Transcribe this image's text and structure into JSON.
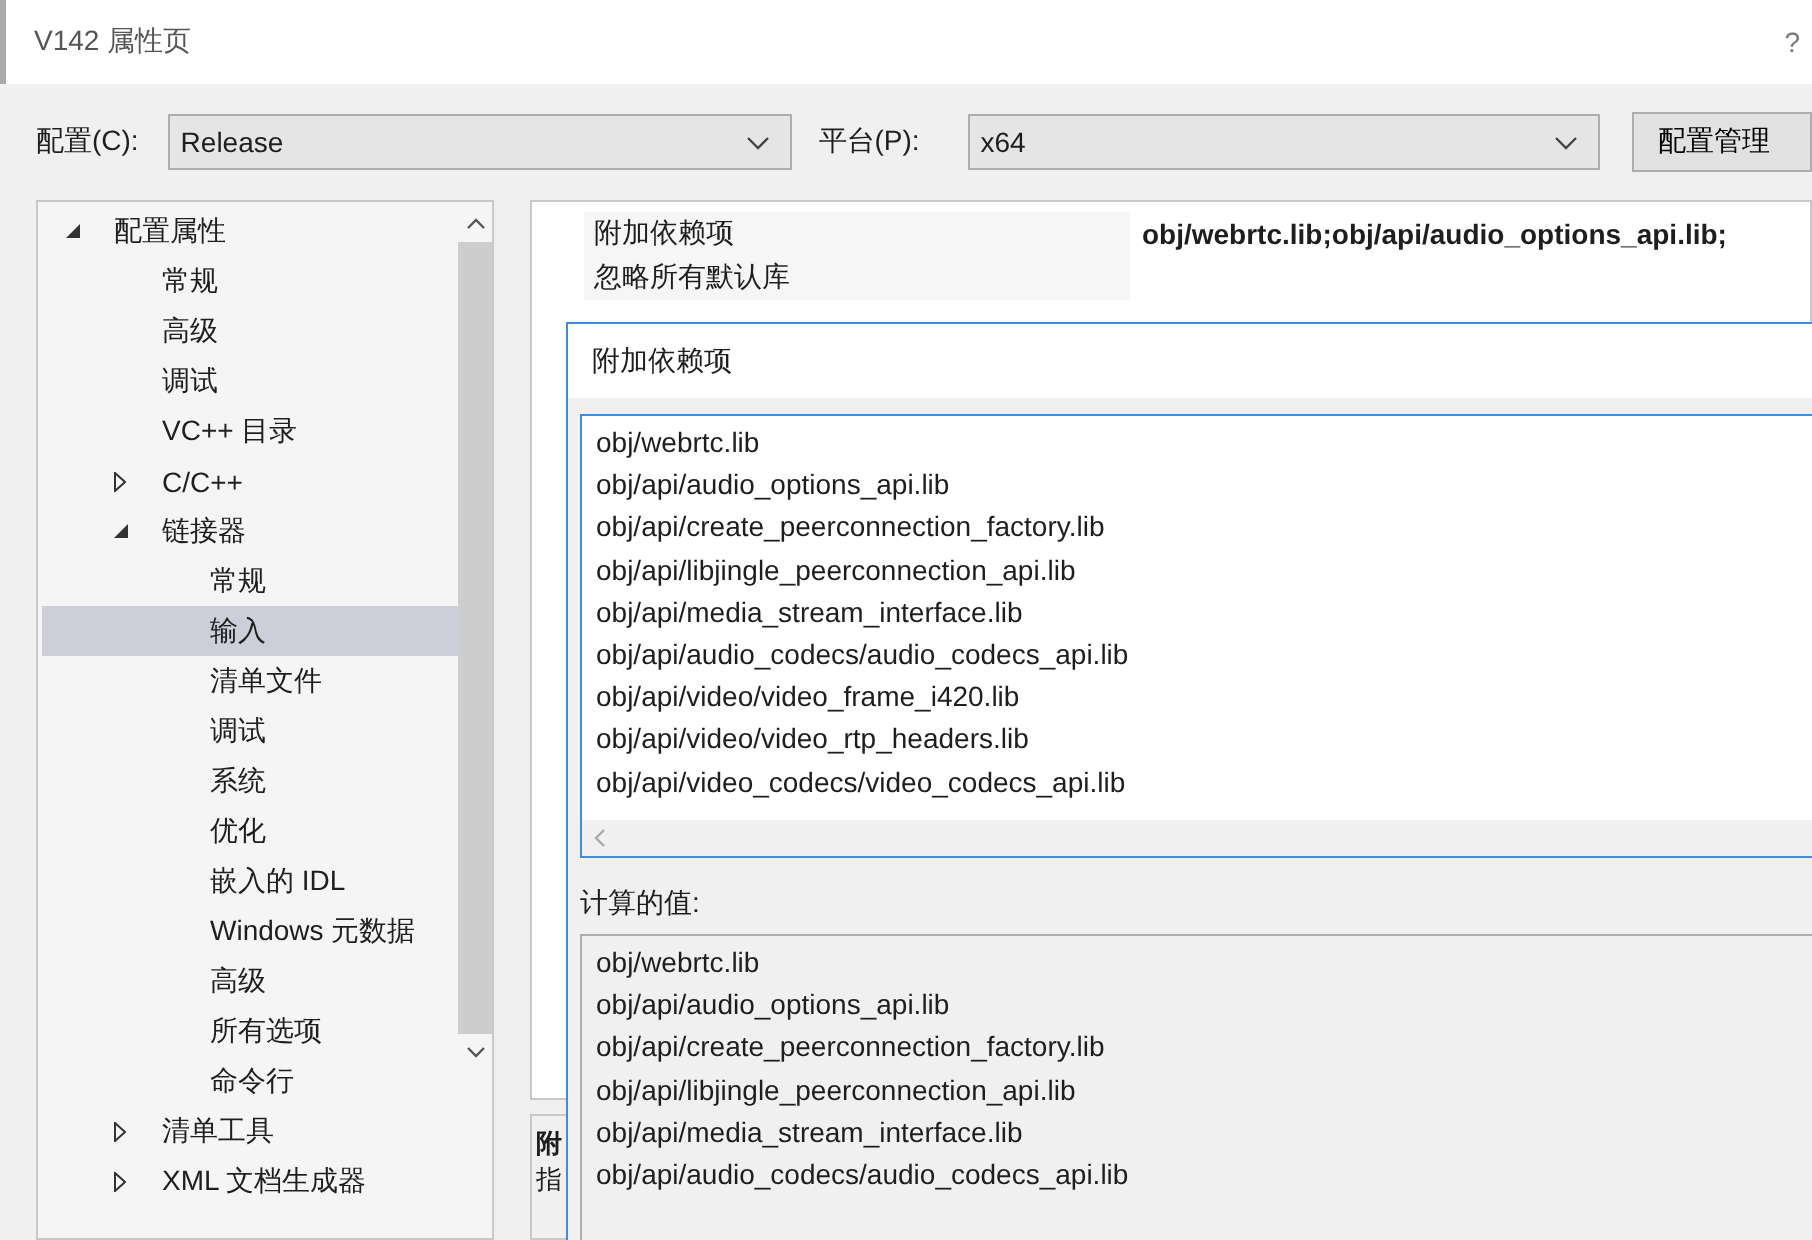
{
  "window": {
    "title": "V142 属性页",
    "help": "?"
  },
  "config_bar": {
    "config_label": "配置(C):",
    "config_value": "Release",
    "platform_label": "平台(P):",
    "platform_value": "x64",
    "manager_button": "配置管理"
  },
  "tree": [
    {
      "label": "配置属性",
      "expanded": true,
      "selected": false,
      "children": [
        {
          "label": "常规",
          "selected": false
        },
        {
          "label": "高级",
          "selected": false
        },
        {
          "label": "调试",
          "selected": false
        },
        {
          "label": "VC++ 目录",
          "selected": false
        },
        {
          "label": "C/C++",
          "expanded": false,
          "selected": false
        },
        {
          "label": "链接器",
          "expanded": true,
          "selected": false,
          "children": [
            {
              "label": "常规",
              "selected": false
            },
            {
              "label": "输入",
              "selected": true
            },
            {
              "label": "清单文件",
              "selected": false
            },
            {
              "label": "调试",
              "selected": false
            },
            {
              "label": "系统",
              "selected": false
            },
            {
              "label": "优化",
              "selected": false
            },
            {
              "label": "嵌入的 IDL",
              "selected": false
            },
            {
              "label": "Windows 元数据",
              "selected": false
            },
            {
              "label": "高级",
              "selected": false
            },
            {
              "label": "所有选项",
              "selected": false
            },
            {
              "label": "命令行",
              "selected": false
            }
          ]
        },
        {
          "label": "清单工具",
          "expanded": false,
          "selected": false
        },
        {
          "label": "XML 文档生成器",
          "expanded": false,
          "selected": false
        }
      ]
    }
  ],
  "properties": [
    {
      "name": "附加依赖项",
      "value": "obj/webrtc.lib;obj/api/audio_options_api.lib;"
    },
    {
      "name": "忽略所有默认库"
    }
  ],
  "description": {
    "title": "附",
    "text": "指"
  },
  "dialog": {
    "title": "附加依赖项",
    "edit_lines": [
      "obj/webrtc.lib",
      "obj/api/audio_options_api.lib",
      "obj/api/create_peerconnection_factory.lib",
      "obj/api/libjingle_peerconnection_api.lib",
      "obj/api/media_stream_interface.lib",
      "obj/api/audio_codecs/audio_codecs_api.lib",
      "obj/api/video/video_frame_i420.lib",
      "obj/api/video/video_rtp_headers.lib",
      "obj/api/video_codecs/video_codecs_api.lib"
    ],
    "computed_label": "计算的值:",
    "computed_lines": [
      "obj/webrtc.lib",
      "obj/api/audio_options_api.lib",
      "obj/api/create_peerconnection_factory.lib",
      "obj/api/libjingle_peerconnection_api.lib",
      "obj/api/media_stream_interface.lib",
      "obj/api/audio_codecs/audio_codecs_api.lib"
    ]
  }
}
